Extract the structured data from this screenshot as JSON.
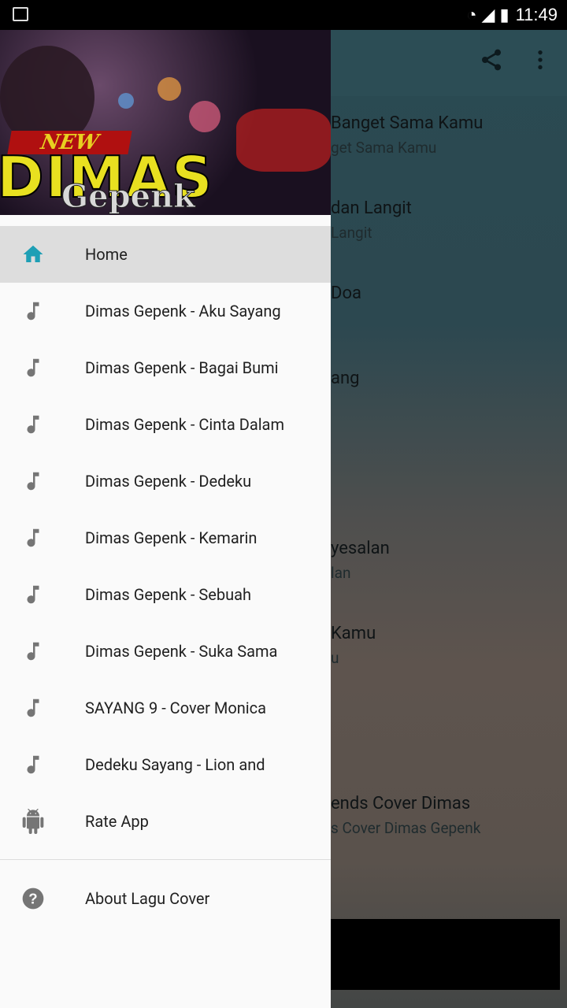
{
  "status_bar": {
    "time": "11:49"
  },
  "toolbar": {
    "share_icon": "share-icon",
    "overflow_icon": "more-vert-icon"
  },
  "song_list": [
    {
      "title": "Banget Sama Kamu",
      "subtitle": "get Sama Kamu"
    },
    {
      "title": "dan Langit",
      "subtitle": "Langit"
    },
    {
      "title": "Doa",
      "subtitle": ""
    },
    {
      "title": "ang",
      "subtitle": ""
    },
    {
      "title": "",
      "subtitle": ""
    },
    {
      "title": "yesalan",
      "subtitle": "lan"
    },
    {
      "title": "Kamu",
      "subtitle": "u"
    },
    {
      "title": "",
      "subtitle": ""
    },
    {
      "title": "ends Cover Dimas",
      "subtitle": "s Cover Dimas Gepenk"
    }
  ],
  "drawer": {
    "header": {
      "logo_new": "NEW",
      "logo_title": "DIMAS",
      "logo_sub": "Gepenk"
    },
    "items": [
      {
        "label": "Home",
        "icon": "home-icon",
        "active": true
      },
      {
        "label": "Dimas Gepenk - Aku Sayang",
        "icon": "music-note-icon"
      },
      {
        "label": "Dimas Gepenk - Bagai Bumi",
        "icon": "music-note-icon"
      },
      {
        "label": "Dimas Gepenk - Cinta Dalam",
        "icon": "music-note-icon"
      },
      {
        "label": "Dimas Gepenk - Dedeku",
        "icon": "music-note-icon"
      },
      {
        "label": "Dimas Gepenk - Kemarin",
        "icon": "music-note-icon"
      },
      {
        "label": "Dimas Gepenk - Sebuah",
        "icon": "music-note-icon"
      },
      {
        "label": "Dimas Gepenk - Suka Sama",
        "icon": "music-note-icon"
      },
      {
        "label": "SAYANG 9 - Cover Monica",
        "icon": "music-note-icon"
      },
      {
        "label": "Dedeku Sayang - Lion and",
        "icon": "music-note-icon"
      },
      {
        "label": "Rate App",
        "icon": "android-icon"
      }
    ],
    "footer_items": [
      {
        "label": "About Lagu Cover",
        "icon": "help-icon"
      }
    ]
  },
  "colors": {
    "accent": "#1e9fb5",
    "active_bg": "#dddddd",
    "drawer_bg": "#fafafa"
  }
}
